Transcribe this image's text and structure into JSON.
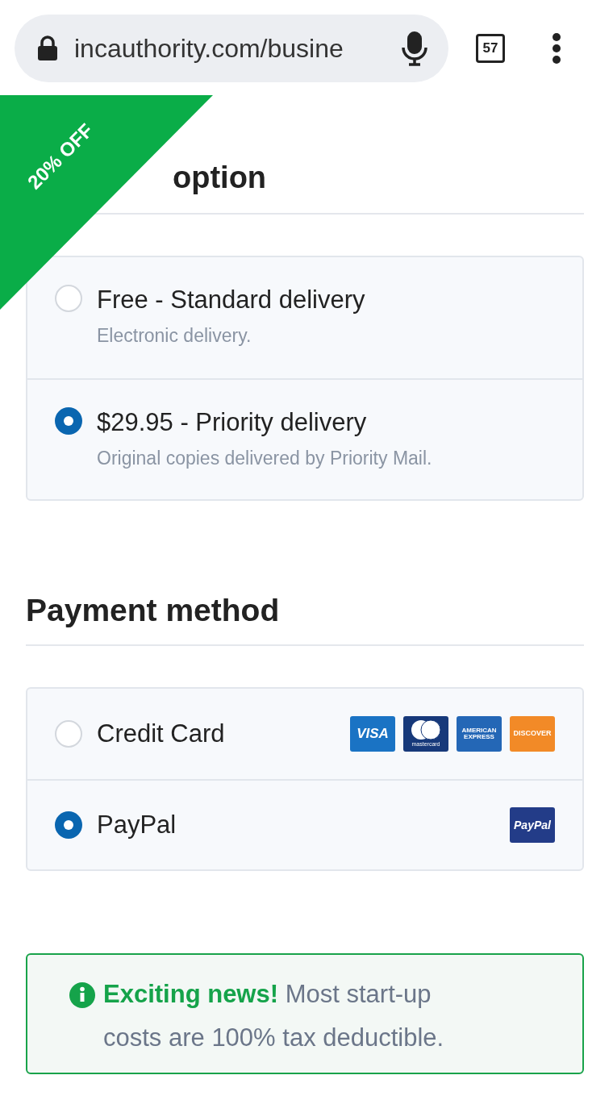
{
  "browser": {
    "url": "incauthority.com/busine",
    "tab_count": "57"
  },
  "ribbon": {
    "text": "20% OFF"
  },
  "sections": [
    {
      "heading": "option",
      "options": [
        {
          "title": "Free - Standard delivery",
          "subtitle": "Electronic delivery.",
          "selected": false
        },
        {
          "title": "$29.95 - Priority delivery",
          "subtitle": "Original copies delivered by Priority Mail.",
          "selected": true
        }
      ]
    },
    {
      "heading": "Payment method",
      "options": [
        {
          "title": "Credit Card",
          "selected": false,
          "logos": [
            {
              "kind": "visa",
              "text": "VISA"
            },
            {
              "kind": "mastercard",
              "text": "mastercard"
            },
            {
              "kind": "amex",
              "text": "AMERICAN EXPRESS"
            },
            {
              "kind": "discover",
              "text": "DISCOVER"
            }
          ]
        },
        {
          "title": "PayPal",
          "selected": true,
          "logos": [
            {
              "kind": "paypal",
              "text": "PayPal"
            }
          ]
        }
      ]
    }
  ],
  "notice": {
    "text": "**Exciting news!** Most start-up costs are 100% tax deductible."
  }
}
